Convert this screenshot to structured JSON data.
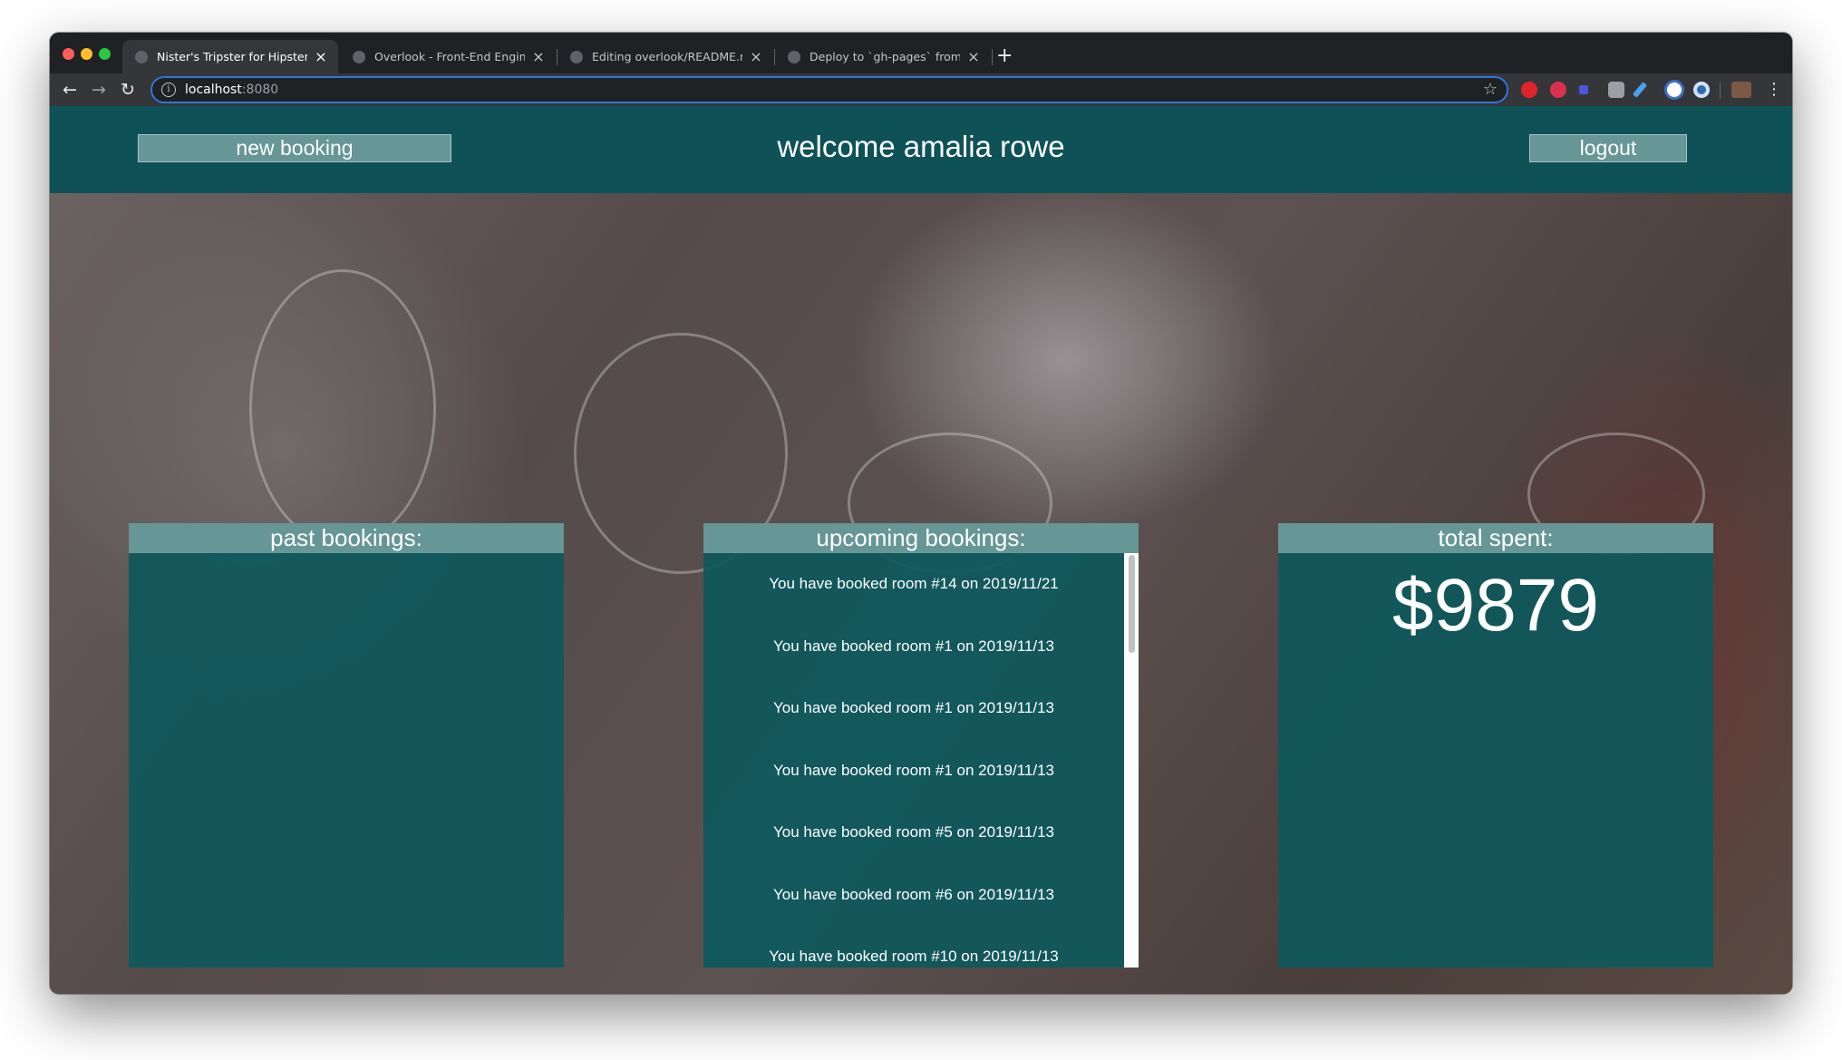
{
  "browser": {
    "tabs": [
      {
        "title": "Nister's Tripster for Hipsters",
        "active": true
      },
      {
        "title": "Overlook - Front-End Engineering",
        "active": false
      },
      {
        "title": "Editing overlook/README.md at",
        "active": false
      },
      {
        "title": "Deploy to `gh-pages` from a `d",
        "active": false
      }
    ],
    "new_tab": "+",
    "close_glyph": "×",
    "url": {
      "host": "localhost",
      "port": ":8080"
    }
  },
  "header": {
    "new_booking": "new booking",
    "welcome": "welcome amalia rowe",
    "logout": "logout"
  },
  "panels": {
    "past": {
      "title": "past bookings:"
    },
    "upcoming": {
      "title": "upcoming bookings:",
      "items": [
        "You have booked room #14 on 2019/11/21",
        "You have booked room #1 on 2019/11/13",
        "You have booked room #1 on 2019/11/13",
        "You have booked room #1 on 2019/11/13",
        "You have booked room #5 on 2019/11/13",
        "You have booked room #6 on 2019/11/13",
        "You have booked room #10 on 2019/11/13"
      ]
    },
    "total": {
      "title": "total spent:",
      "amount": "$9879"
    }
  },
  "colors": {
    "header_bg": "#0e5258",
    "panel_bg": "#0e585c",
    "button_bg": "#669696"
  }
}
